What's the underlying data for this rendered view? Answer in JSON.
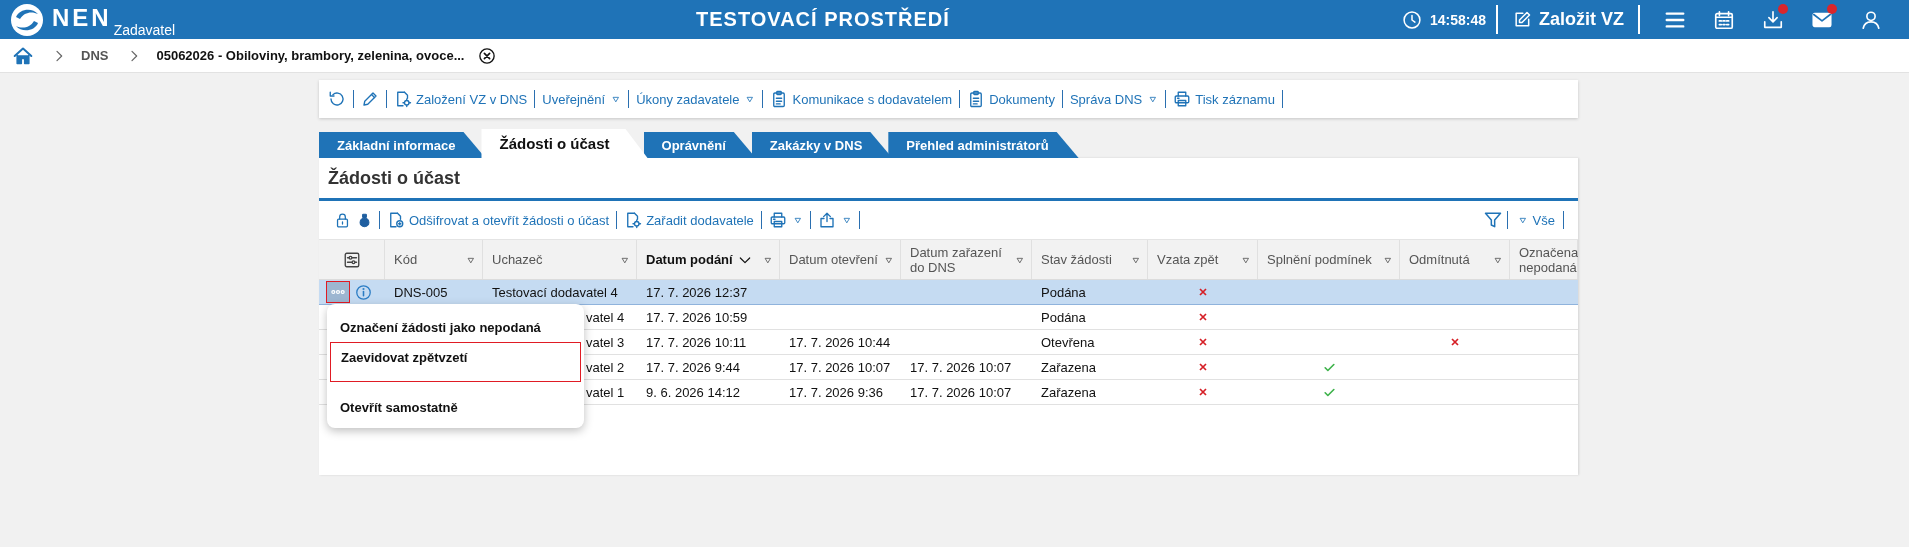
{
  "header": {
    "brand": "NEN",
    "role": "Zadavatel",
    "title": "TESTOVACÍ PROSTŘEDÍ",
    "time": "14:58:48",
    "create_button": "Založit VZ",
    "icons": [
      {
        "kind": "menu",
        "badge": false
      },
      {
        "kind": "calendar",
        "badge": false
      },
      {
        "kind": "download",
        "badge": true
      },
      {
        "kind": "mail",
        "badge": true
      },
      {
        "kind": "user",
        "badge": false
      }
    ]
  },
  "breadcrumb": [
    "DNS",
    "05062026 - Obiloviny, brambory, zelenina, ovoce..."
  ],
  "toolbar": [
    {
      "kind": "refresh"
    },
    {
      "kind": "edit"
    },
    {
      "kind": "gear",
      "label": "Založení VZ v DNS",
      "dropdown": false
    },
    {
      "kind": "plain",
      "label": "Uveřejnění",
      "dropdown": true
    },
    {
      "kind": "plain",
      "label": "Úkony zadavatele",
      "dropdown": true
    },
    {
      "kind": "clipboard",
      "label": "Komunikace s dodavatelem",
      "dropdown": false
    },
    {
      "kind": "clipboard",
      "label": "Dokumenty",
      "dropdown": false
    },
    {
      "kind": "plain",
      "label": "Správa DNS",
      "dropdown": true
    },
    {
      "kind": "printer",
      "label": "Tisk záznamu",
      "dropdown": false
    }
  ],
  "tabs": [
    {
      "label": "Základní informace",
      "selected": false
    },
    {
      "label": "Žádosti o účast",
      "selected": true
    },
    {
      "label": "Oprávnění",
      "selected": false
    },
    {
      "label": "Zakázky v DNS",
      "selected": false
    },
    {
      "label": "Přehled administrátorů",
      "selected": false
    }
  ],
  "section": {
    "title": "Žádosti o účast",
    "toolbar": [
      {
        "kind": "lock"
      },
      {
        "kind": "seal"
      },
      {
        "kind": "doc",
        "label": "Odšifrovat a otevřít žádosti o účast",
        "dropdown": false
      },
      {
        "kind": "gear",
        "label": "Zařadit dodavatele",
        "dropdown": false
      },
      {
        "kind": "printer",
        "dropdown": true
      },
      {
        "kind": "export",
        "dropdown": true
      }
    ],
    "filter_label": "Vše",
    "table": {
      "columns": [
        {
          "label": "Kód",
          "sorted": false
        },
        {
          "label": "Uchazeč",
          "sorted": false
        },
        {
          "label": "Datum podání",
          "sorted": true
        },
        {
          "label": "Datum otevření",
          "sorted": false
        },
        {
          "label": "Datum zařazení do DNS",
          "sorted": false
        },
        {
          "label": "Stav žádosti",
          "sorted": false
        },
        {
          "label": "Vzata zpět",
          "sorted": false
        },
        {
          "label": "Splnění podmínek",
          "sorted": false
        },
        {
          "label": "Odmítnutá",
          "sorted": false
        },
        {
          "label": "Označena nepodaná",
          "sorted": false
        }
      ],
      "rows": [
        {
          "selected": true,
          "kod": "DNS-005",
          "uchazec": "Testovací dodavatel 4",
          "datum_podani": "17. 7. 2026 12:37",
          "stav": "Podána",
          "vzata_zpet": true,
          "splneni_podminek": false,
          "odmitnuta": false
        },
        {
          "selected": false,
          "uchazec": "vatel 4",
          "datum_podani": "17. 7. 2026 10:59",
          "stav": "Podána",
          "vzata_zpet": true,
          "splneni_podminek": false,
          "odmitnuta": false
        },
        {
          "selected": false,
          "uchazec": "vatel 3",
          "datum_podani": "17. 7. 2026 10:11",
          "datum_otevreni": "17. 7. 2026 10:44",
          "stav": "Otevřena",
          "vzata_zpet": true,
          "splneni_podminek": false,
          "odmitnuta": true
        },
        {
          "selected": false,
          "uchazec": "vatel 2",
          "datum_podani": "17. 7. 2026 9:44",
          "datum_otevreni": "17. 7. 2026 10:07",
          "datum_zarazeni": "17. 7. 2026 10:07",
          "stav": "Zařazena",
          "vzata_zpet": true,
          "splneni_podminek": true,
          "odmitnuta": false
        },
        {
          "selected": false,
          "uchazec": "vatel 1",
          "datum_podani": "9. 6. 2026 14:12",
          "datum_otevreni": "17. 7. 2026 9:36",
          "datum_zarazeni": "17. 7. 2026 10:07",
          "stav": "Zařazena",
          "vzata_zpet": true,
          "splneni_podminek": true,
          "odmitnuta": false
        }
      ]
    },
    "context_menu": [
      {
        "label": "Označení žádosti jako nepodaná",
        "focused": false
      },
      {
        "label": "Zaevidovat zpětvzetí",
        "focused": true
      },
      {
        "label": "Otevřít samostatně",
        "focused": false
      }
    ]
  }
}
